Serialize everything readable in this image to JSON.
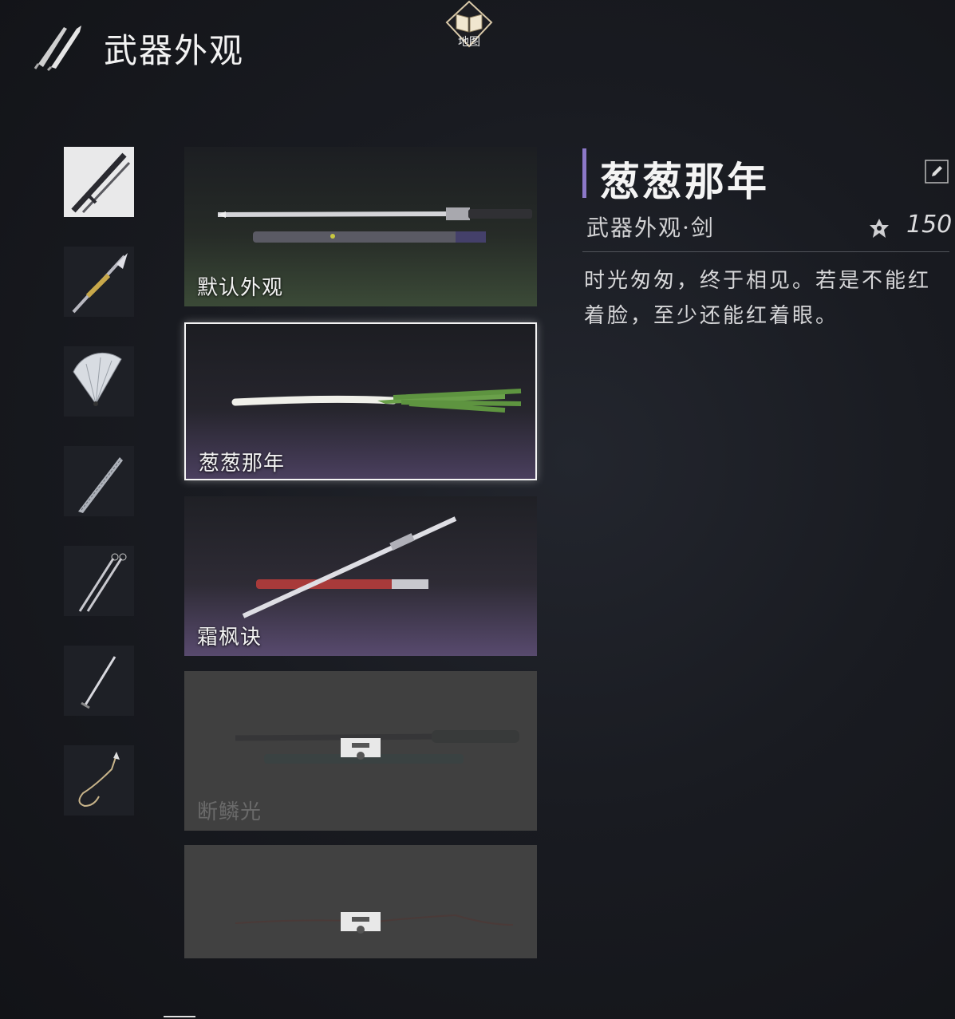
{
  "header": {
    "title": "武器外观",
    "icon": "twin-swords-icon"
  },
  "map_button": {
    "label": "地图",
    "icon": "map-book-icon"
  },
  "categories": [
    {
      "icon": "sword-scabbard-icon",
      "active": true
    },
    {
      "icon": "ornate-spear-icon",
      "active": false
    },
    {
      "icon": "folding-fan-icon",
      "active": false
    },
    {
      "icon": "umbrella-icon",
      "active": false
    },
    {
      "icon": "twin-blades-icon",
      "active": false
    },
    {
      "icon": "long-blade-icon",
      "active": false
    },
    {
      "icon": "rope-dart-icon",
      "active": false
    }
  ],
  "skins": [
    {
      "name": "默认外观",
      "locked": false,
      "selected": false
    },
    {
      "name": "葱葱那年",
      "locked": false,
      "selected": true
    },
    {
      "name": "霜枫诀",
      "locked": false,
      "selected": false
    },
    {
      "name": "断鳞光",
      "locked": true,
      "selected": false
    },
    {
      "name": "",
      "locked": true,
      "selected": false
    }
  ],
  "detail": {
    "title": "葱葱那年",
    "subtitle": "武器外观·剑",
    "price": "150",
    "price_icon": "currency-flower-icon",
    "description": "时光匆匆，终于相见。若是不能红着脸，至少还能红着眼。"
  },
  "colors": {
    "accent": "#8c78c8",
    "background": "#191b21"
  }
}
